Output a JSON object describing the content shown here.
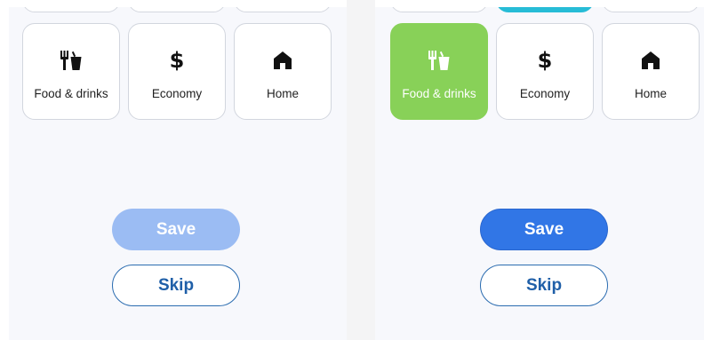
{
  "colors": {
    "panel_bg": "#f7f8fc",
    "selected_card": "#88d158",
    "save_disabled": "#9bbcf3",
    "save_enabled": "#3176e6",
    "skip_text": "#1f5fa8",
    "teal_chip": "#27bcd6"
  },
  "left_screen": {
    "categories": [
      {
        "label": "Food & drinks",
        "icon": "fork-and-drink-icon",
        "selected": false
      },
      {
        "label": "Economy",
        "icon": "dollar-icon",
        "selected": false
      },
      {
        "label": "Home",
        "icon": "house-icon",
        "selected": false
      }
    ],
    "save_label": "Save",
    "save_enabled": false,
    "skip_label": "Skip"
  },
  "right_screen": {
    "categories": [
      {
        "label": "Food & drinks",
        "icon": "fork-and-drink-icon",
        "selected": true
      },
      {
        "label": "Economy",
        "icon": "dollar-icon",
        "selected": false
      },
      {
        "label": "Home",
        "icon": "house-icon",
        "selected": false
      }
    ],
    "save_label": "Save",
    "save_enabled": true,
    "skip_label": "Skip"
  },
  "icons": {
    "dollar_glyph": "$"
  }
}
